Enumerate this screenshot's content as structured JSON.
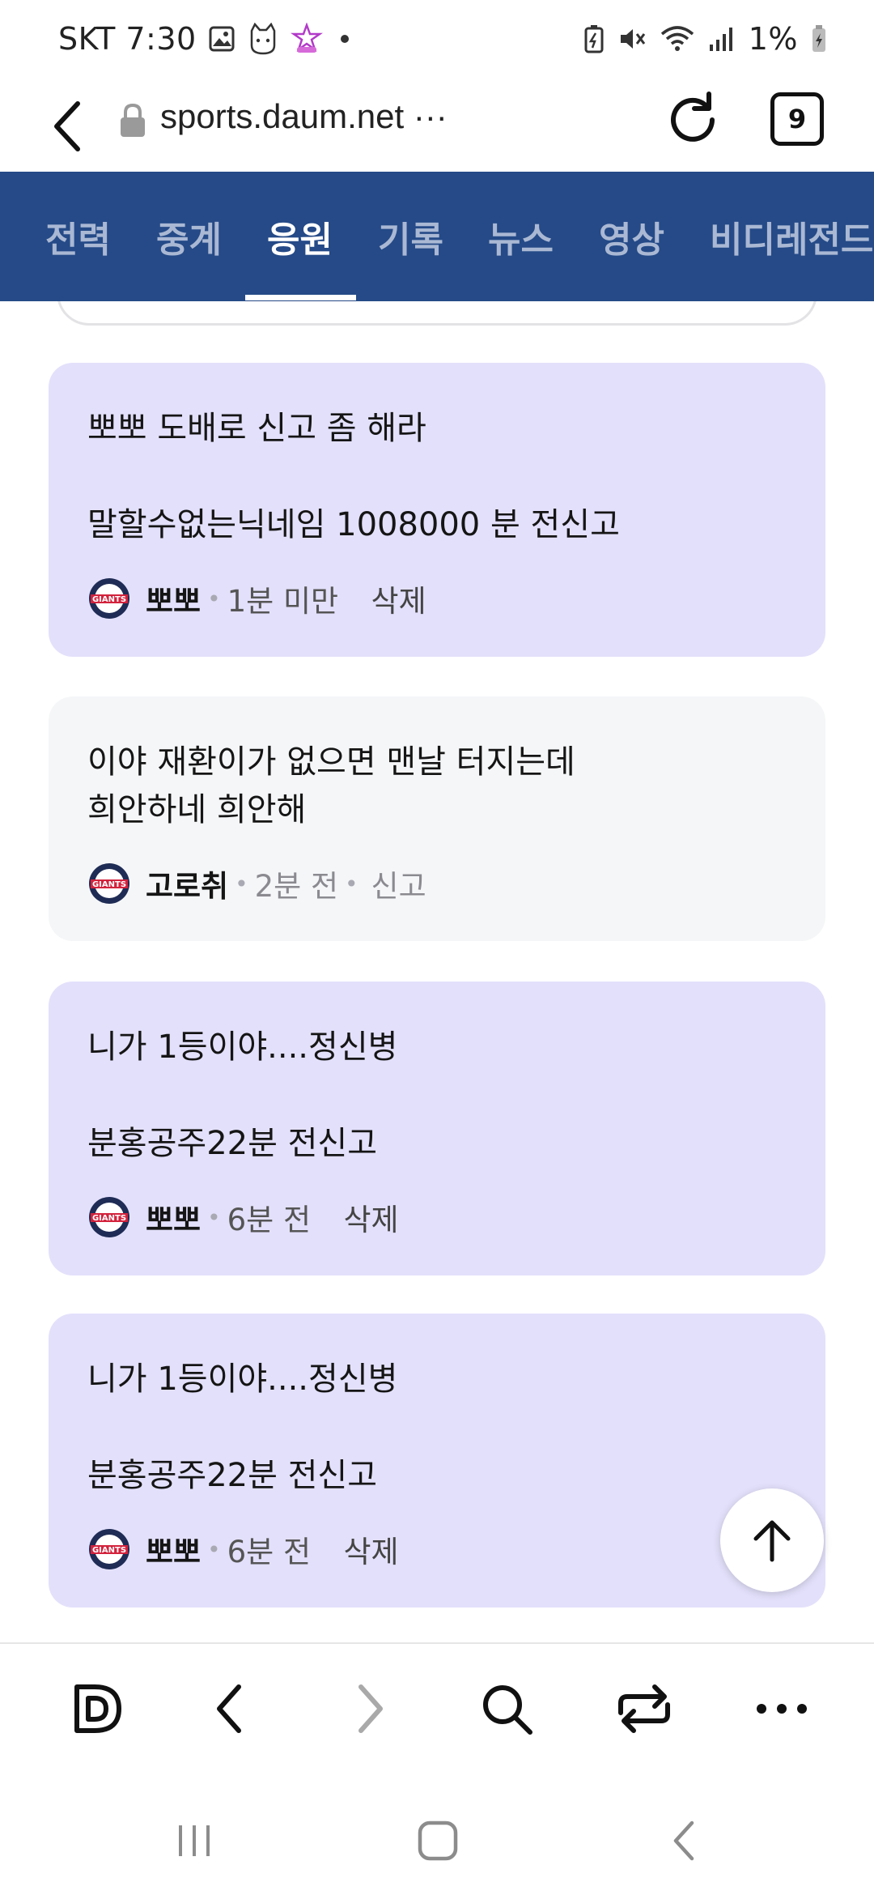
{
  "status_bar": {
    "carrier_time": "SKT 7:30",
    "battery": "1%"
  },
  "browser": {
    "url": "sports.daum.net ···",
    "tab_count": "9"
  },
  "nav": {
    "tabs": [
      {
        "label": "전력"
      },
      {
        "label": "중계"
      },
      {
        "label": "응원"
      },
      {
        "label": "기록"
      },
      {
        "label": "뉴스"
      },
      {
        "label": "영상"
      },
      {
        "label": "비디레전드"
      }
    ],
    "active_index": 2
  },
  "comments": [
    {
      "line1": "뽀뽀 도배로 신고 좀 해라",
      "line2": "말할수없는닉네임 1008000 분 전신고",
      "nickname": "뽀뽀",
      "time": "1분 미만",
      "action": "삭제"
    },
    {
      "line1": "이야 재환이가 없으면 맨날 터지는데",
      "line2": "희안하네 희안해",
      "nickname": "고로취",
      "time": "2분 전",
      "action": "신고"
    },
    {
      "line1": "니가 1등이야....정신병",
      "line2": "분홍공주22분 전신고",
      "nickname": "뽀뽀",
      "time": "6분 전",
      "action": "삭제"
    },
    {
      "line1": "니가 1등이야....정신병",
      "line2": "분홍공주22분 전신고",
      "nickname": "뽀뽀",
      "time": "6분 전",
      "action": "삭제"
    }
  ],
  "colors": {
    "nav_bg": "#254a87",
    "my_comment_bg": "#e3e0fb",
    "other_comment_bg": "#f5f6f8"
  },
  "icons": {
    "fab": "arrow-up-icon",
    "toolbar": [
      "daum-d-icon",
      "back-icon",
      "forward-icon",
      "search-icon",
      "share-icon",
      "more-icon"
    ],
    "system": [
      "recents-icon",
      "home-icon",
      "system-back-icon"
    ]
  }
}
